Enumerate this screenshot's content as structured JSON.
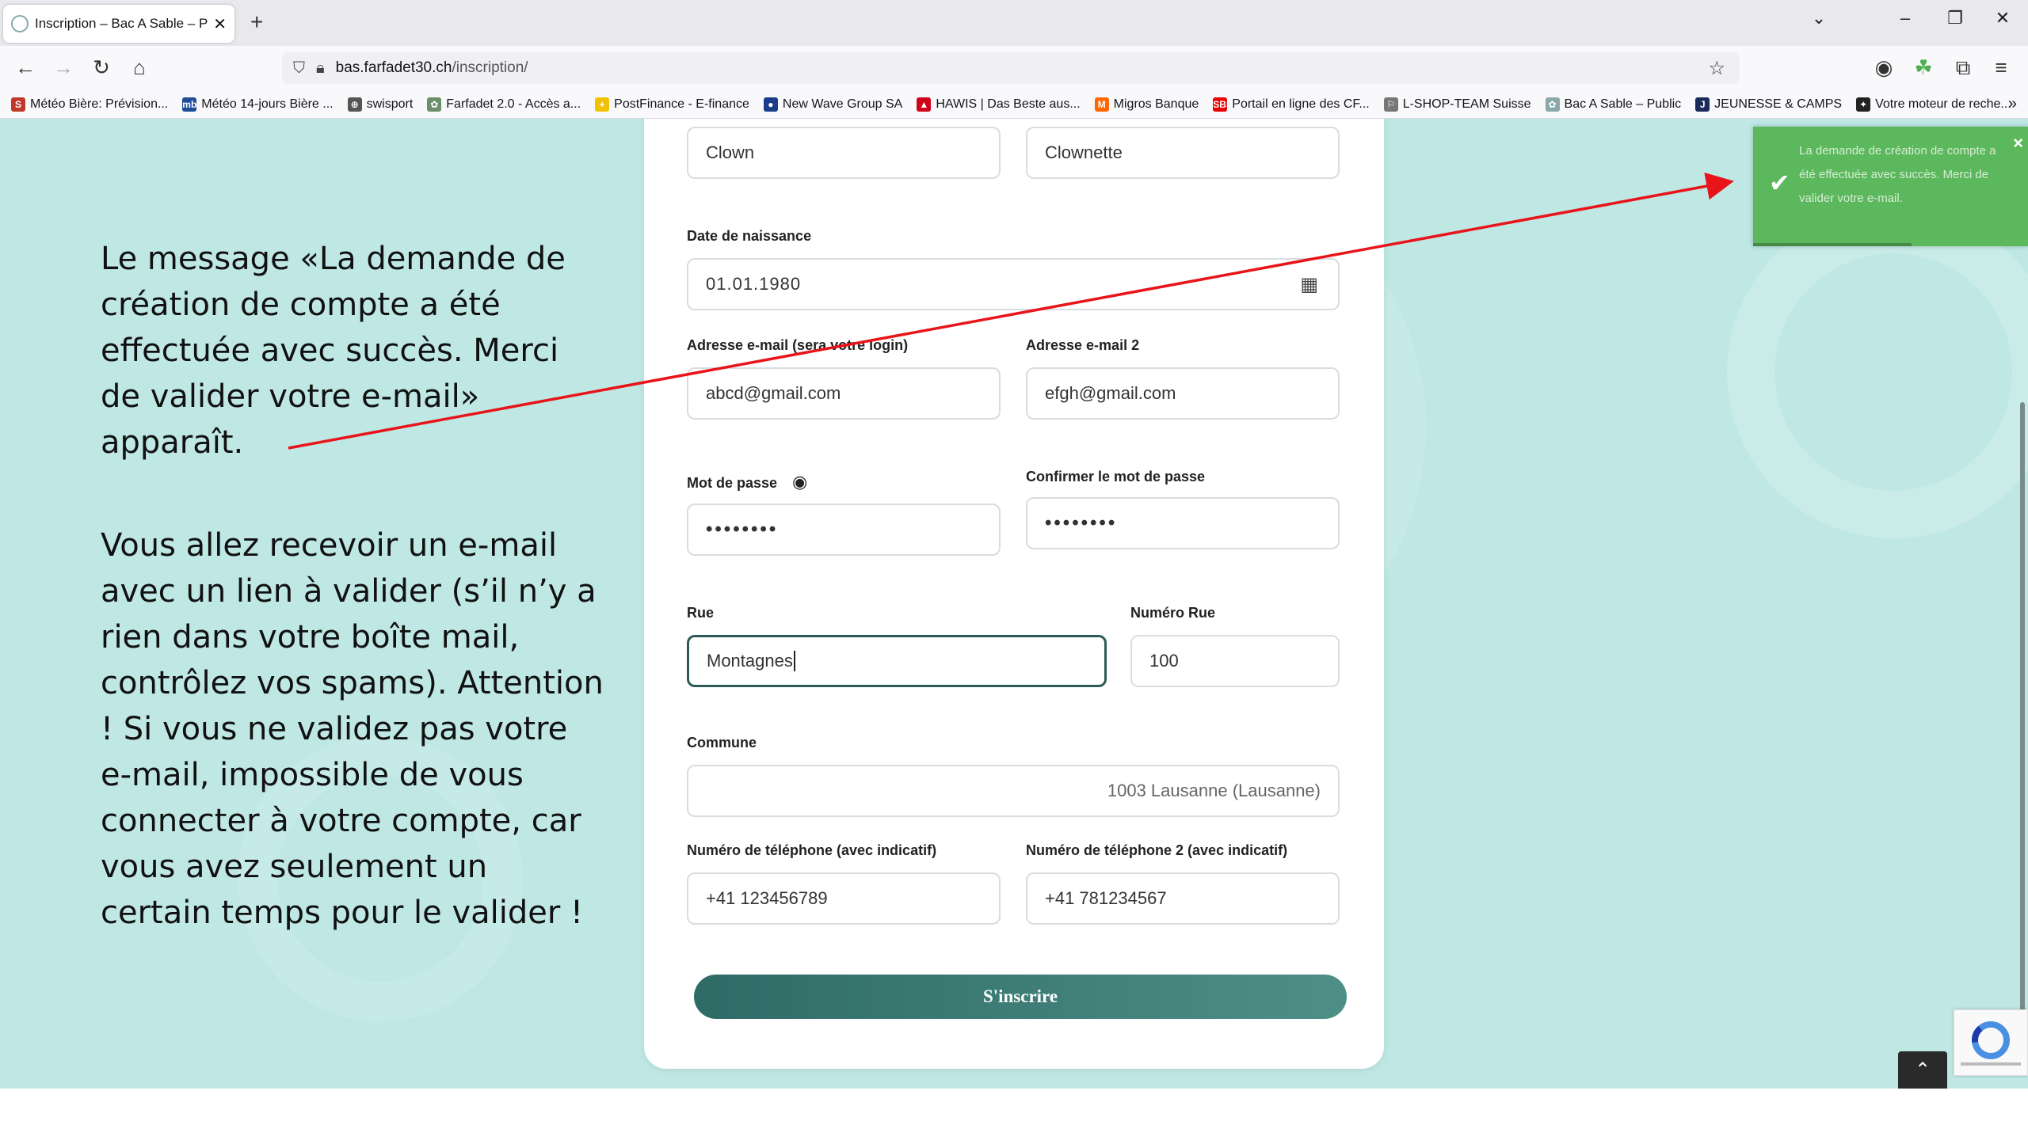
{
  "browser": {
    "tab_title": "Inscription – Bac A Sable – Pass",
    "url_host": "bas.farfadet30.ch",
    "url_path": "/inscription/",
    "bookmarks": [
      {
        "label": "Météo Bière: Prévision...",
        "icon": "S",
        "color": "#c0392b"
      },
      {
        "label": "Météo 14-jours Bière ...",
        "icon": "mb",
        "color": "#1f4e99"
      },
      {
        "label": "swisport",
        "icon": "⊕",
        "color": "#555555"
      },
      {
        "label": "Farfadet 2.0 - Accès a...",
        "icon": "✿",
        "color": "#6b8e6b"
      },
      {
        "label": "PostFinance - E-finance",
        "icon": "+",
        "color": "#f2c200"
      },
      {
        "label": "New Wave Group SA",
        "icon": "●",
        "color": "#1a3c8a"
      },
      {
        "label": "HAWIS | Das Beste aus...",
        "icon": "▲",
        "color": "#d0021b"
      },
      {
        "label": "Migros Banque",
        "icon": "M",
        "color": "#ff6600"
      },
      {
        "label": "Portail en ligne des CF...",
        "icon": "SBB",
        "color": "#eb0000"
      },
      {
        "label": "L-SHOP-TEAM Suisse",
        "icon": "⚐",
        "color": "#777777"
      },
      {
        "label": "Bac A Sable – Public",
        "icon": "✿",
        "color": "#8aa8a8"
      },
      {
        "label": "JEUNESSE & CAMPS",
        "icon": "J",
        "color": "#1a2a5a"
      },
      {
        "label": "Votre moteur de reche...",
        "icon": "✦",
        "color": "#222222"
      }
    ]
  },
  "instructions": {
    "para1": "Le message «La demande de création de compte a été effectuée avec succès. Merci de valider votre e-mail» apparaît.",
    "para2": "Vous allez recevoir un e-mail avec un lien à valider (s’il n’y a rien dans votre boîte mail, contrôlez vos spams). Attention ! Si vous ne validez pas votre e-mail, impossible de vous connecter à votre compte, car vous avez seulement un certain temps pour le valider !"
  },
  "form": {
    "lastname_value": "Clown",
    "firstname_value": "Clownette",
    "birthdate_label": "Date de naissance",
    "birthdate_value": "01.01.1980",
    "email_label": "Adresse e-mail (sera votre login)",
    "email_value": "abcd@gmail.com",
    "email2_label": "Adresse e-mail 2",
    "email2_value": "efgh@gmail.com",
    "password_label": "Mot de passe",
    "password_value": "••••••••",
    "password_confirm_label": "Confirmer le mot de passe",
    "password_confirm_value": "••••••••",
    "street_label": "Rue",
    "street_value": "Montagnes",
    "street_number_label": "Numéro Rue",
    "street_number_value": "100",
    "commune_label": "Commune",
    "commune_value": "1003 Lausanne (Lausanne)",
    "phone_label": "Numéro de téléphone (avec indicatif)",
    "phone_value": "+41 123456789",
    "phone2_label": "Numéro de téléphone 2 (avec indicatif)",
    "phone2_value": "+41 781234567",
    "submit_label": "S'inscrire"
  },
  "toast": {
    "message": "La demande de création de compte a été effectuée avec succès. Merci de valider votre e-mail.",
    "color": "#5cb85c"
  },
  "colors": {
    "page_bg": "#bfe8e5",
    "accent": "#2f6b66",
    "arrow": "#e8141a"
  },
  "icons": {
    "calendar": "calendar-icon",
    "eye": "eye-icon",
    "check": "check-icon"
  }
}
